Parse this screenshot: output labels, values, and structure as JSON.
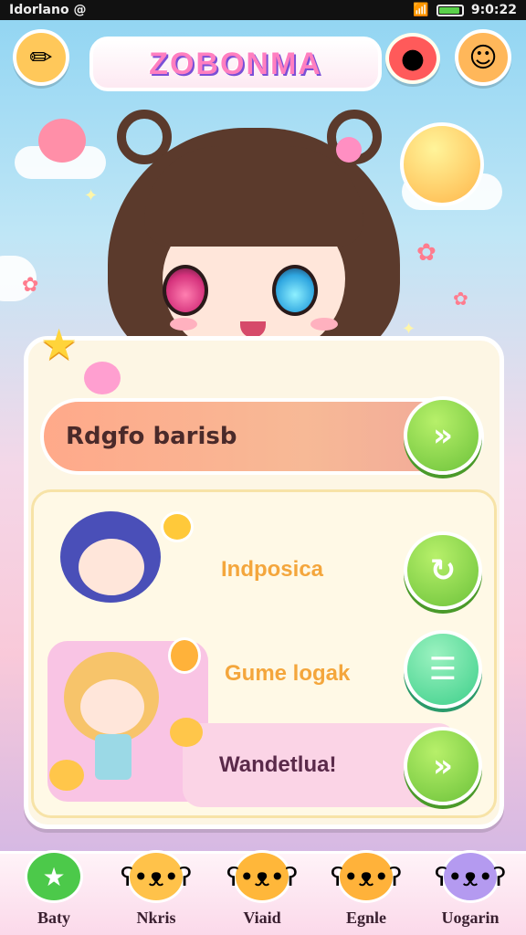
{
  "status": {
    "left": "Idorlano  @",
    "time": "9:0:22"
  },
  "header": {
    "logo": "ZOBONMA",
    "left_icon": "pencil-icon",
    "right_icon": "smiley-icon"
  },
  "main": {
    "primary_bar": {
      "label": "Rdgfo barisb"
    },
    "rows": [
      {
        "label": "Indposica",
        "button_icon": "refresh-icon"
      },
      {
        "label": "Gume logak",
        "button_icon": "menu-icon"
      },
      {
        "label": "Wandetlua!",
        "button_icon": "forward-icon"
      }
    ]
  },
  "nav": {
    "items": [
      {
        "label": "Baty",
        "icon": "star-icon"
      },
      {
        "label": "Nkris",
        "icon": "bear-icon"
      },
      {
        "label": "Viaid",
        "icon": "bear-icon"
      },
      {
        "label": "Egnle",
        "icon": "bear-icon"
      },
      {
        "label": "Uogarin",
        "icon": "bear-icon"
      }
    ]
  },
  "colors": {
    "accent": "#6cc23a",
    "pink": "#ff7fc0",
    "orange": "#f4a63c"
  }
}
